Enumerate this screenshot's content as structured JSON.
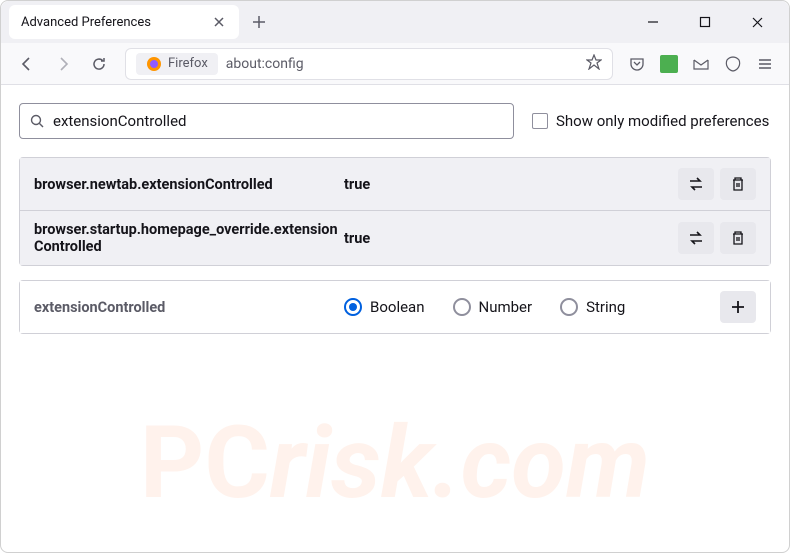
{
  "tab": {
    "title": "Advanced Preferences"
  },
  "addressbar": {
    "label": "Firefox",
    "url": "about:config"
  },
  "search": {
    "value": "extensionControlled",
    "checkbox_label": "Show only modified preferences"
  },
  "prefs": [
    {
      "name": "browser.newtab.extensionControlled",
      "value": "true"
    },
    {
      "name": "browser.startup.homepage_override.extensionControlled",
      "value": "true"
    }
  ],
  "add": {
    "name": "extensionControlled",
    "types": [
      "Boolean",
      "Number",
      "String"
    ],
    "selected": "Boolean"
  },
  "watermark": {
    "pc": "PC",
    "rest": "risk.com"
  }
}
